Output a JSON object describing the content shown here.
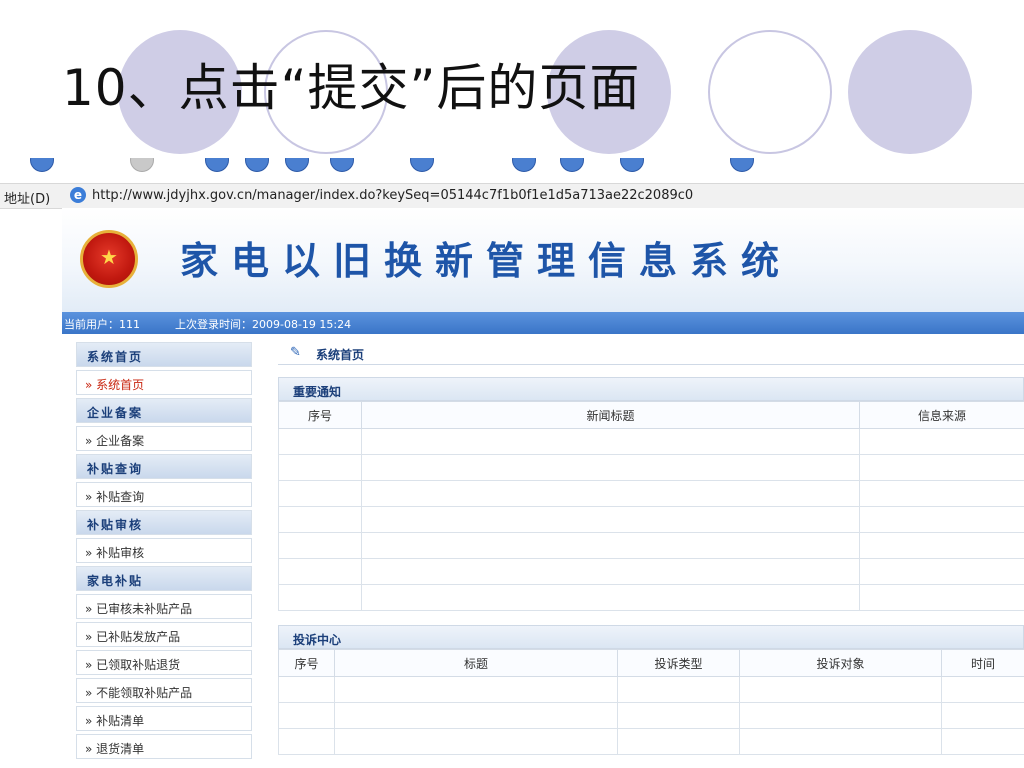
{
  "slide": {
    "title": "10、点击“提交”后的页面"
  },
  "browser": {
    "address_label": "地址(D)",
    "url": "http://www.jdyjhx.gov.cn/manager/index.do?keySeq=05144c7f1b0f1e1d5a713ae22c2089c0"
  },
  "app": {
    "title": "家电以旧换新管理信息系统",
    "status": {
      "current_user": "当前用户：111",
      "last_login": "上次登录时间：2009-08-19 15:24"
    }
  },
  "sidebar": {
    "groups": [
      {
        "heading": "系统首页",
        "items": [
          "» 系统首页"
        ]
      },
      {
        "heading": "企业备案",
        "items": [
          "» 企业备案"
        ]
      },
      {
        "heading": "补贴查询",
        "items": [
          "» 补贴查询"
        ]
      },
      {
        "heading": "补贴审核",
        "items": [
          "» 补贴审核"
        ]
      },
      {
        "heading": "家电补贴",
        "items": [
          "» 已审核未补贴产品",
          "» 已补贴发放产品",
          "» 已领取补贴退货",
          "» 不能领取补贴产品",
          "» 补贴清单",
          "» 退货清单"
        ]
      }
    ]
  },
  "main": {
    "breadcrumb": "系统首页",
    "notices": {
      "title": "重要通知",
      "columns": [
        "序号",
        "新闻标题",
        "信息来源"
      ]
    },
    "complaints": {
      "title": "投诉中心",
      "columns": [
        "序号",
        "标题",
        "投诉类型",
        "投诉对象",
        "时间"
      ]
    }
  }
}
